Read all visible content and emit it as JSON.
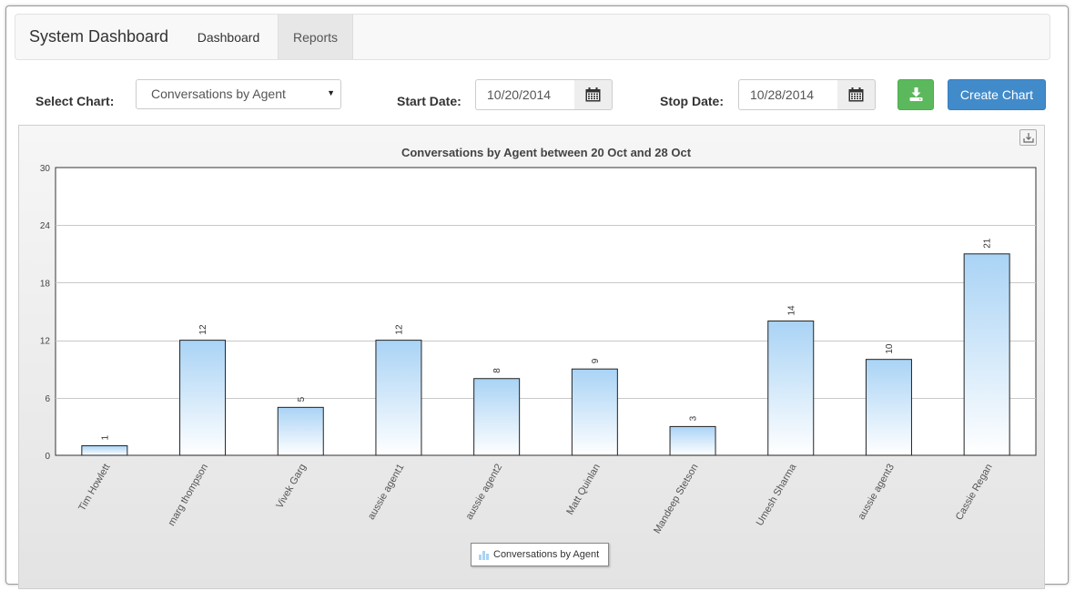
{
  "navbar": {
    "brand": "System Dashboard",
    "tabs": [
      {
        "label": "Dashboard",
        "active": false
      },
      {
        "label": "Reports",
        "active": true
      }
    ]
  },
  "controls": {
    "select_chart_label": "Select Chart:",
    "select_chart_value": "Conversations by Agent",
    "start_date_label": "Start Date:",
    "start_date_value": "10/20/2014",
    "stop_date_label": "Stop Date:",
    "stop_date_value": "10/28/2014",
    "create_button": "Create Chart"
  },
  "colors": {
    "primary": "#428bca",
    "success": "#5cb85c",
    "bar_top": "#a9d3f5",
    "bar_bottom": "#ffffff"
  },
  "chart_data": {
    "type": "bar",
    "title": "Conversations by Agent between 20 Oct and 28 Oct",
    "xlabel": "",
    "ylabel": "",
    "ylim": [
      0,
      30
    ],
    "yticks": [
      0,
      6,
      12,
      18,
      24,
      30
    ],
    "grid": true,
    "legend_position": "bottom-center",
    "categories": [
      "Tim Howlett",
      "marg thompson",
      "Vivek Garg",
      "aussie agent1",
      "aussie agent2",
      "Matt Quinlan",
      "Mandeep Stetson",
      "Umesh Sharma",
      "aussie agent3",
      "Cassie Regan"
    ],
    "series": [
      {
        "name": "Conversations by Agent",
        "values": [
          1,
          12,
          5,
          12,
          8,
          9,
          3,
          14,
          10,
          21
        ]
      }
    ]
  }
}
